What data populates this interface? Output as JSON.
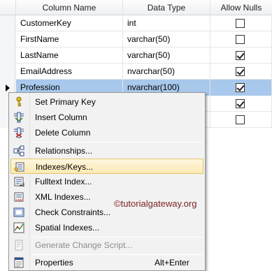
{
  "columns_header": {
    "col1": "Column Name",
    "col2": "Data Type",
    "col3": "Allow Nulls"
  },
  "rows": [
    {
      "name": "CustomerKey",
      "type": "int",
      "allow_nulls": false
    },
    {
      "name": "FirstName",
      "type": "varchar(50)",
      "allow_nulls": false
    },
    {
      "name": "LastName",
      "type": "varchar(50)",
      "allow_nulls": true
    },
    {
      "name": "EmailAddress",
      "type": "nvarchar(50)",
      "allow_nulls": true
    },
    {
      "name": "Profession",
      "type": "nvarchar(100)",
      "allow_nulls": true,
      "selected": true
    },
    {
      "name": "",
      "type": "",
      "allow_nulls": true
    },
    {
      "name": "",
      "type": "",
      "allow_nulls": false
    }
  ],
  "context_menu": {
    "items": [
      {
        "label": "Set Primary Key",
        "icon": "key-icon"
      },
      {
        "label": "Insert Column",
        "icon": "insert-column-icon"
      },
      {
        "label": "Delete Column",
        "icon": "delete-column-icon"
      },
      {
        "label": "Relationships...",
        "icon": "relationships-icon"
      },
      {
        "label": "Indexes/Keys...",
        "icon": "indexes-keys-icon",
        "highlighted": true
      },
      {
        "label": "Fulltext Index...",
        "icon": "fulltext-index-icon"
      },
      {
        "label": "XML Indexes...",
        "icon": "xml-indexes-icon"
      },
      {
        "label": "Check Constraints...",
        "icon": "check-constraints-icon"
      },
      {
        "label": "Spatial Indexes...",
        "icon": "spatial-indexes-icon"
      },
      {
        "label": "Generate Change Script...",
        "icon": "generate-script-icon",
        "disabled": true
      },
      {
        "label": "Properties",
        "icon": "properties-icon",
        "shortcut": "Alt+Enter"
      }
    ]
  },
  "watermark": "©tutorialgateway.org",
  "colors": {
    "selected_row": "#a8c8ec",
    "menu_highlight": "#fbe9b4",
    "watermark": "#7a1f1f"
  }
}
